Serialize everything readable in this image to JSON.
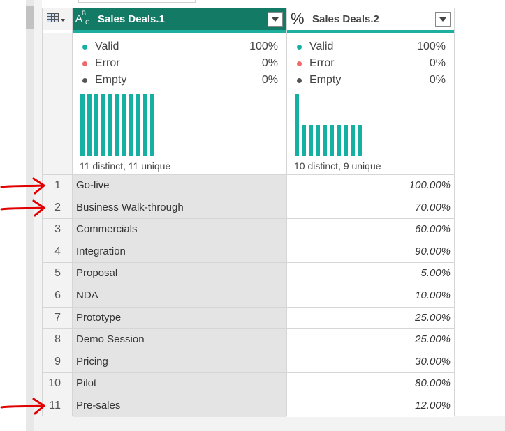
{
  "columns": [
    {
      "title": "Sales Deals.1",
      "type_icon": "abc-text-type-icon",
      "valid_label": "Valid",
      "valid_pct": "100%",
      "error_label": "Error",
      "error_pct": "0%",
      "empty_label": "Empty",
      "empty_pct": "0%",
      "distinct_text": "11 distinct, 11 unique",
      "distribution": [
        1,
        1,
        1,
        1,
        1,
        1,
        1,
        1,
        1,
        1,
        1
      ]
    },
    {
      "title": "Sales Deals.2",
      "type_icon": "percent-type-icon",
      "type_symbol": "%",
      "valid_label": "Valid",
      "valid_pct": "100%",
      "error_label": "Error",
      "error_pct": "0%",
      "empty_label": "Empty",
      "empty_pct": "0%",
      "distinct_text": "10 distinct, 9 unique",
      "distribution": [
        2,
        1,
        1,
        1,
        1,
        1,
        1,
        1,
        1,
        1
      ]
    }
  ],
  "rows": [
    {
      "index": "1",
      "name": "Go-live",
      "value": "100.00%",
      "arrow": true
    },
    {
      "index": "2",
      "name": "Business Walk-through",
      "value": "70.00%",
      "arrow": true
    },
    {
      "index": "3",
      "name": "Commercials",
      "value": "60.00%",
      "arrow": false
    },
    {
      "index": "4",
      "name": "Integration",
      "value": "90.00%",
      "arrow": false
    },
    {
      "index": "5",
      "name": "Proposal",
      "value": "5.00%",
      "arrow": false
    },
    {
      "index": "6",
      "name": "NDA",
      "value": "10.00%",
      "arrow": false
    },
    {
      "index": "7",
      "name": "Prototype",
      "value": "25.00%",
      "arrow": false
    },
    {
      "index": "8",
      "name": "Demo Session",
      "value": "25.00%",
      "arrow": false
    },
    {
      "index": "9",
      "name": "Pricing",
      "value": "30.00%",
      "arrow": false
    },
    {
      "index": "10",
      "name": "Pilot",
      "value": "80.00%",
      "arrow": false
    },
    {
      "index": "11",
      "name": "Pre-sales",
      "value": "12.00%",
      "arrow": true
    }
  ],
  "colors": {
    "header_active": "#137a66",
    "accent": "#1dafa0",
    "valid_dot": "#16b0a3",
    "error_dot": "#f06a6a",
    "empty_dot": "#555555",
    "annotation_arrow": "#e00000"
  }
}
